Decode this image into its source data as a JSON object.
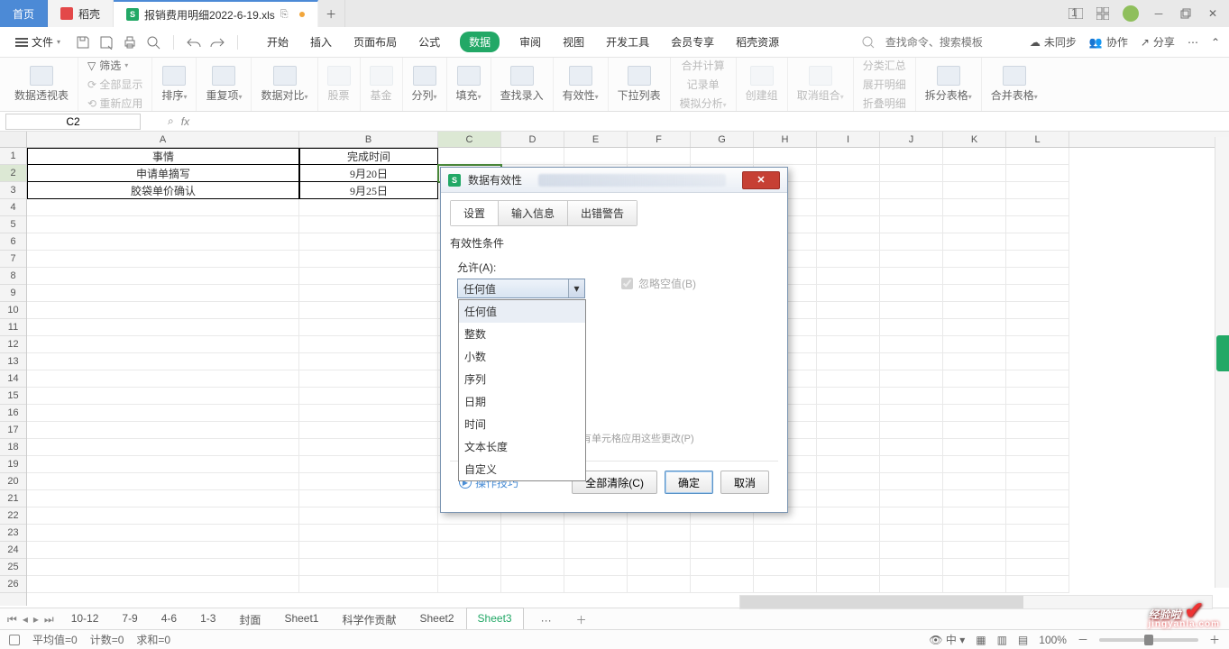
{
  "titlebar": {
    "home": "首页",
    "daoke": "稻壳",
    "doc": "报销费用明细2022-6-19.xls"
  },
  "menubar": {
    "file": "文件",
    "tabs": [
      "开始",
      "插入",
      "页面布局",
      "公式",
      "数据",
      "审阅",
      "视图",
      "开发工具",
      "会员专享",
      "稻壳资源"
    ],
    "search_ph": "查找命令、搜索模板",
    "unsync": "未同步",
    "collab": "协作",
    "share": "分享"
  },
  "ribbon": {
    "pivot": "数据透视表",
    "filter": "筛选",
    "showall": "全部显示",
    "reapply": "重新应用",
    "sort": "排序",
    "dup": "重复项",
    "compare": "数据对比",
    "stock": "股票",
    "fund": "基金",
    "split": "分列",
    "fill": "填充",
    "findrec": "查找录入",
    "validity": "有效性",
    "dropdown": "下拉列表",
    "consol": "合并计算",
    "record": "记录单",
    "sim": "模拟分析",
    "group": "创建组",
    "ungroup": "取消组合",
    "subtotal": "分类汇总",
    "expand": "展开明细",
    "collapse": "折叠明细",
    "splittbl": "拆分表格",
    "mergetbl": "合并表格"
  },
  "namebox": "C2",
  "headers": [
    "A",
    "B",
    "C",
    "D",
    "E",
    "F",
    "G",
    "H",
    "I",
    "J",
    "K",
    "L"
  ],
  "rows": "26",
  "cells": {
    "A1": "事情",
    "B1": "完成时间",
    "A2": "申请单摘写",
    "B2": "9月20日",
    "A3": "胶袋单价确认",
    "B3": "9月25日"
  },
  "sheets": {
    "items": [
      "10-12",
      "7-9",
      "4-6",
      "1-3",
      "封面",
      "Sheet1",
      "科学作贡献",
      "Sheet2",
      "Sheet3"
    ],
    "more": "···",
    "active": "Sheet3"
  },
  "status": {
    "avg": "平均值=0",
    "cnt": "计数=0",
    "sum": "求和=0",
    "zoom": "100%"
  },
  "dialog": {
    "title": "数据有效性",
    "tabs": [
      "设置",
      "输入信息",
      "出错警告"
    ],
    "cond": "有效性条件",
    "allow": "允许(A):",
    "allow_value": "任何值",
    "options": [
      "任何值",
      "整数",
      "小数",
      "序列",
      "日期",
      "时间",
      "文本长度",
      "自定义"
    ],
    "skip": "忽略空值(B)",
    "apply": "有单元格应用这些更改(P)",
    "tips": "操作技巧",
    "clear": "全部清除(C)",
    "ok": "确定",
    "cancel": "取消"
  },
  "watermark": {
    "cn": "经验啦",
    "sub": "jingyanla.com"
  }
}
